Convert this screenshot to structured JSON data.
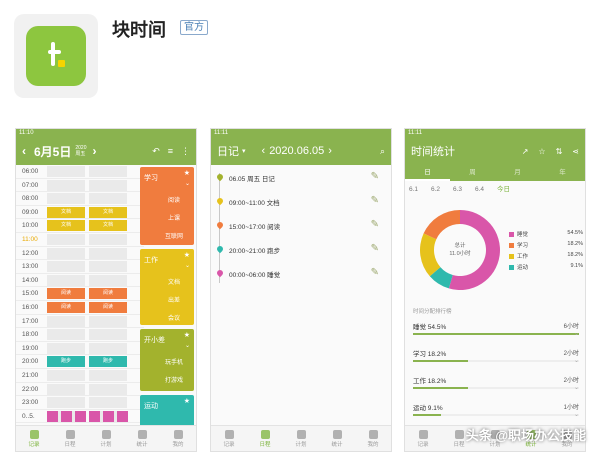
{
  "app": {
    "title": "块时间",
    "badge": "官方",
    "logo_letter": "t"
  },
  "colors": {
    "brand_green": "#8ab34f",
    "study_orange": "#f07c3e",
    "work_yellow": "#e6c21c",
    "sport_teal": "#2fb9ad",
    "sleep_pink": "#d956a9",
    "fun_green": "#a3b22d"
  },
  "phone1": {
    "status_time": "11:10",
    "date": "6月5日",
    "year": "2020",
    "weekday": "周五",
    "hours": [
      "06:00",
      "07:00",
      "08:00",
      "09:00",
      "10:00",
      "11:00",
      "12:00",
      "13:00",
      "14:00",
      "15:00",
      "16:00",
      "17:00",
      "18:00",
      "19:00",
      "20:00",
      "21:00",
      "22:00",
      "23:00",
      "0..5."
    ],
    "now_hour": "11:00",
    "blocks": {
      "doc": "文档",
      "read": "阅读",
      "run": "跑步"
    },
    "categories": [
      {
        "name": "学习",
        "items": [
          "阅读",
          "上课",
          "互联网"
        ]
      },
      {
        "name": "工作",
        "items": [
          "文档",
          "出差",
          "会议"
        ]
      },
      {
        "name": "开小差",
        "items": [
          "玩手机",
          "打游戏"
        ]
      },
      {
        "name": "运动",
        "items": []
      }
    ],
    "nav": [
      "记录",
      "日程",
      "计划",
      "统计",
      "我的"
    ]
  },
  "phone2": {
    "status_time": "11:11",
    "title": "日记",
    "date": "2020.06.05",
    "entries": [
      {
        "text": "06.05 周五 日记",
        "color": "#a3b22d"
      },
      {
        "text": "09:00~11:00 文档",
        "color": "#e6c21c"
      },
      {
        "text": "15:00~17:00 阅读",
        "color": "#f07c3e"
      },
      {
        "text": "20:00~21:00 跑步",
        "color": "#2fb9ad"
      },
      {
        "text": "00:00~06:00 睡觉",
        "color": "#d956a9"
      }
    ],
    "nav": [
      "记录",
      "日程",
      "计划",
      "统计",
      "我的"
    ]
  },
  "phone3": {
    "status_time": "11:11",
    "title": "时间统计",
    "tabs": [
      "日",
      "周",
      "月",
      "年"
    ],
    "days": [
      "6.1",
      "6.2",
      "6.3",
      "6.4",
      "今日"
    ],
    "total_label": "总计",
    "total_value": "11.0小时",
    "legend": [
      {
        "name": "睡觉",
        "pct": "54.5%",
        "color": "#d956a9"
      },
      {
        "name": "学习",
        "pct": "18.2%",
        "color": "#f07c3e"
      },
      {
        "name": "工作",
        "pct": "18.2%",
        "color": "#e6c21c"
      },
      {
        "name": "运动",
        "pct": "9.1%",
        "color": "#2fb9ad"
      }
    ],
    "rank_title": "时间分配排行榜",
    "ranking": [
      {
        "name": "睡觉",
        "pct": "54.5%",
        "hours": "6小时",
        "fraction": 1.0
      },
      {
        "name": "学习",
        "pct": "18.2%",
        "hours": "2小时",
        "fraction": 0.33
      },
      {
        "name": "工作",
        "pct": "18.2%",
        "hours": "2小时",
        "fraction": 0.33
      },
      {
        "name": "运动",
        "pct": "9.1%",
        "hours": "1小时",
        "fraction": 0.17
      }
    ],
    "nav": [
      "记录",
      "日程",
      "计划",
      "统计",
      "我的"
    ]
  },
  "watermark": "头条 @职场办公技能"
}
